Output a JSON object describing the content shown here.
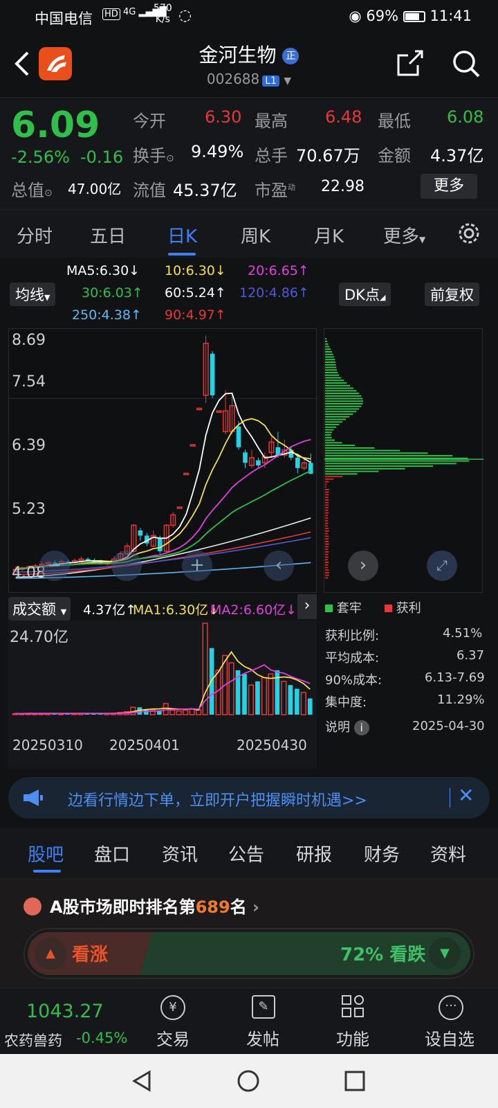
{
  "status": {
    "carrier": "中国电信",
    "speed": "570",
    "speed_unit": "K/s",
    "battery": "69%",
    "time": "11:41"
  },
  "header": {
    "title": "金河生物",
    "title_badge": "正",
    "code": "002688",
    "level": "L1"
  },
  "quote": {
    "price": "6.09",
    "change_pct": "-2.56%",
    "change": "-0.16",
    "open_label": "今开",
    "open": "6.30",
    "high_label": "最高",
    "high": "6.48",
    "low_label": "最低",
    "low": "6.08",
    "turnover_label": "换手",
    "turnover": "9.49%",
    "volume_label": "总手",
    "volume": "70.67万",
    "amount_label": "金额",
    "amount": "4.37亿",
    "mktcap_label": "总值",
    "mktcap": "47.00亿",
    "float_label": "流值",
    "float": "45.37亿",
    "pe_label": "市盈",
    "pe_sup": "动",
    "pe": "22.98",
    "more": "更多"
  },
  "period_tabs": [
    "分时",
    "五日",
    "日K",
    "周K",
    "月K",
    "更多"
  ],
  "ma_legend": {
    "ma5": "MA5:6.30↓",
    "ma10": "10:6.30↓",
    "ma20": "20:6.65↑",
    "ma30": "30:6.03↑",
    "ma60": "60:5.24↑",
    "ma120": "120:4.86↑",
    "ma250": "250:4.38↑",
    "ma90": "90:4.97↑",
    "ma_button": "均线",
    "dk_button": "DK点",
    "adj_button": "前复权"
  },
  "colors": {
    "up": "#e53935",
    "down": "#22d3e6",
    "price_down": "#2fbf4a",
    "accent": "#3b82f6"
  },
  "chart_data": [
    {
      "type": "candlestick",
      "y_ticks": [
        "8.69",
        "7.54",
        "6.39",
        "5.23",
        "4.08"
      ],
      "ylim": [
        4.08,
        8.69
      ],
      "candles": [
        {
          "o": 4.25,
          "c": 4.25,
          "h": 4.3,
          "l": 4.2
        },
        {
          "o": 4.26,
          "c": 4.28,
          "h": 4.3,
          "l": 4.22
        },
        {
          "o": 4.28,
          "c": 4.3,
          "h": 4.33,
          "l": 4.25
        },
        {
          "o": 4.3,
          "c": 4.32,
          "h": 4.36,
          "l": 4.28
        },
        {
          "o": 4.32,
          "c": 4.35,
          "h": 4.4,
          "l": 4.3
        },
        {
          "o": 4.35,
          "c": 4.38,
          "h": 4.42,
          "l": 4.32
        },
        {
          "o": 4.38,
          "c": 4.35,
          "h": 4.42,
          "l": 4.33
        },
        {
          "o": 4.36,
          "c": 4.4,
          "h": 4.44,
          "l": 4.34
        },
        {
          "o": 4.4,
          "c": 4.38,
          "h": 4.44,
          "l": 4.35
        },
        {
          "o": 4.38,
          "c": 4.42,
          "h": 4.46,
          "l": 4.36
        },
        {
          "o": 4.42,
          "c": 4.45,
          "h": 4.5,
          "l": 4.4
        },
        {
          "o": 4.45,
          "c": 4.43,
          "h": 4.48,
          "l": 4.4
        },
        {
          "o": 4.42,
          "c": 4.4,
          "h": 4.46,
          "l": 4.38
        },
        {
          "o": 4.4,
          "c": 4.36,
          "h": 4.44,
          "l": 4.34
        },
        {
          "o": 4.36,
          "c": 4.38,
          "h": 4.42,
          "l": 4.33
        },
        {
          "o": 4.38,
          "c": 4.45,
          "h": 4.5,
          "l": 4.36
        },
        {
          "o": 4.45,
          "c": 4.55,
          "h": 4.6,
          "l": 4.43
        },
        {
          "o": 4.55,
          "c": 4.7,
          "h": 4.75,
          "l": 4.52
        },
        {
          "o": 4.6,
          "c": 5.1,
          "h": 5.12,
          "l": 4.58
        },
        {
          "o": 5.0,
          "c": 4.9,
          "h": 5.05,
          "l": 4.8
        },
        {
          "o": 4.9,
          "c": 4.75,
          "h": 4.95,
          "l": 4.7
        },
        {
          "o": 4.7,
          "c": 4.9,
          "h": 5.0,
          "l": 4.68
        },
        {
          "o": 4.85,
          "c": 4.6,
          "h": 4.9,
          "l": 4.55
        },
        {
          "o": 4.6,
          "c": 5.1,
          "h": 5.12,
          "l": 4.58
        },
        {
          "o": 5.1,
          "c": 5.3,
          "h": 5.35,
          "l": 5.05
        },
        {
          "o": 5.45,
          "c": 5.45,
          "h": 5.46,
          "l": 5.44
        },
        {
          "o": 6.1,
          "c": 6.1,
          "h": 6.11,
          "l": 6.09
        },
        {
          "o": 6.65,
          "c": 6.65,
          "h": 6.66,
          "l": 6.64
        },
        {
          "o": 7.35,
          "c": 7.35,
          "h": 7.36,
          "l": 7.34
        },
        {
          "o": 7.6,
          "c": 8.6,
          "h": 8.75,
          "l": 7.45
        },
        {
          "o": 8.4,
          "c": 7.6,
          "h": 8.45,
          "l": 7.55
        },
        {
          "o": 7.3,
          "c": 7.3,
          "h": 7.31,
          "l": 7.29
        },
        {
          "o": 6.9,
          "c": 7.3,
          "h": 7.7,
          "l": 6.85
        },
        {
          "o": 6.9,
          "c": 7.4,
          "h": 7.6,
          "l": 6.85
        },
        {
          "o": 7.0,
          "c": 6.6,
          "h": 7.1,
          "l": 6.55
        },
        {
          "o": 6.5,
          "c": 6.3,
          "h": 6.55,
          "l": 6.2
        },
        {
          "o": 6.25,
          "c": 6.4,
          "h": 6.55,
          "l": 6.2
        },
        {
          "o": 6.35,
          "c": 6.25,
          "h": 6.4,
          "l": 6.2
        },
        {
          "o": 6.3,
          "c": 6.42,
          "h": 6.5,
          "l": 6.2
        },
        {
          "o": 6.5,
          "c": 6.7,
          "h": 6.8,
          "l": 6.4
        },
        {
          "o": 6.6,
          "c": 6.45,
          "h": 6.9,
          "l": 6.4
        },
        {
          "o": 6.45,
          "c": 6.55,
          "h": 6.75,
          "l": 6.4
        },
        {
          "o": 6.55,
          "c": 6.4,
          "h": 6.6,
          "l": 6.35
        },
        {
          "o": 6.4,
          "c": 6.2,
          "h": 6.45,
          "l": 6.1
        },
        {
          "o": 6.2,
          "c": 6.3,
          "h": 6.4,
          "l": 6.15
        },
        {
          "o": 6.3,
          "c": 6.09,
          "h": 6.48,
          "l": 6.08
        }
      ]
    },
    {
      "type": "bar",
      "series_name": "成交额",
      "y_top_label": "24.70亿",
      "x_labels": [
        "20250310",
        "20250401",
        "20250430"
      ],
      "values": [
        0.3,
        0.3,
        0.35,
        0.3,
        0.32,
        0.33,
        0.35,
        0.3,
        0.32,
        0.34,
        0.36,
        0.33,
        0.3,
        0.32,
        0.33,
        0.38,
        0.6,
        0.8,
        2.0,
        2.0,
        1.5,
        1.3,
        1.0,
        3.0,
        1.2,
        1.0,
        1.2,
        1.5,
        1.3,
        24.7,
        18.0,
        12.0,
        16.0,
        14.0,
        12.0,
        11.0,
        8.0,
        9.0,
        10.0,
        11.0,
        12.0,
        9.0,
        8.0,
        7.0,
        6.0,
        4.37
      ]
    }
  ],
  "volume_legend": {
    "label": "成交额",
    "value": "4.37亿↑",
    "ma1": "MA1:6.30亿↓",
    "ma2": "MA2:6.60亿↓"
  },
  "chip": {
    "legend_trapped": "套牢",
    "legend_profit": "获利",
    "profit_ratio_label": "获利比例:",
    "profit_ratio": "4.51%",
    "avg_cost_label": "平均成本:",
    "avg_cost": "6.37",
    "cost90_label": "90%成本:",
    "cost90": "6.13-7.69",
    "concentration_label": "集中度:",
    "concentration": "11.29%",
    "note_label": "说明",
    "date": "2025-04-30"
  },
  "banner": {
    "text": "边看行情边下单，立即开户把握瞬时机遇>>"
  },
  "bottom_tabs": [
    "股吧",
    "盘口",
    "资讯",
    "公告",
    "研报",
    "财务",
    "资料"
  ],
  "rank": {
    "prefix": "A股市场即时排名第",
    "rank": "689",
    "suffix": "名",
    "bull": "看涨",
    "bear_pct": "72%",
    "bear": "看跌"
  },
  "bottom_nav": {
    "index_value": "1043.27",
    "index_name": "农药兽药",
    "index_change": "-0.45%",
    "trade": "交易",
    "post": "发帖",
    "func": "功能",
    "watch": "设自选"
  }
}
